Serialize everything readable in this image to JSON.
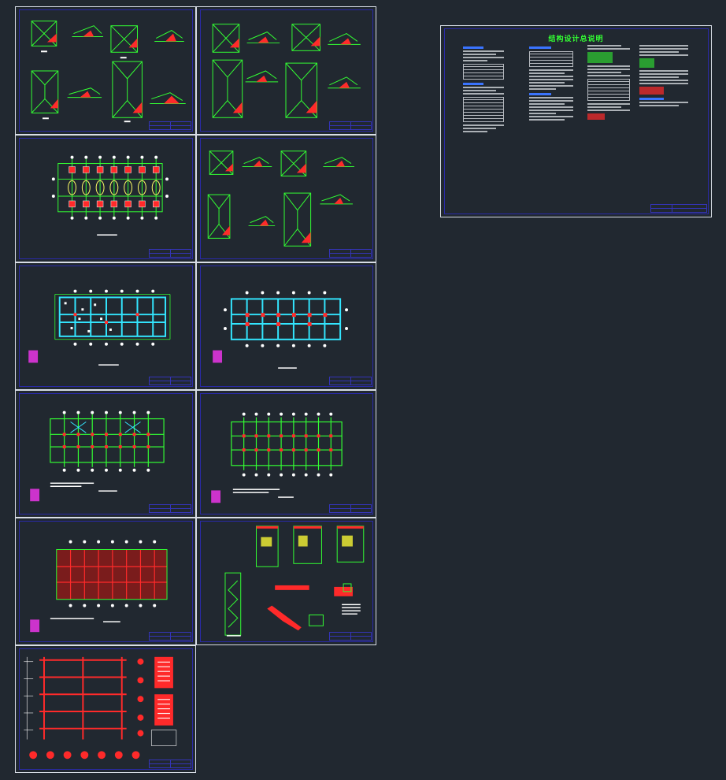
{
  "sheets": [
    {
      "id": "s1",
      "type": "roof-details"
    },
    {
      "id": "s2",
      "type": "roof-details"
    },
    {
      "id": "s3",
      "type": "foundation-plan"
    },
    {
      "id": "s4",
      "type": "roof-details"
    },
    {
      "id": "s5",
      "type": "column-plan"
    },
    {
      "id": "s6",
      "type": "column-plan"
    },
    {
      "id": "s7",
      "type": "beam-plan"
    },
    {
      "id": "s8",
      "type": "beam-plan"
    },
    {
      "id": "s9",
      "type": "slab-plan"
    },
    {
      "id": "s10",
      "type": "stair-details"
    },
    {
      "id": "s11",
      "type": "frame-elevation"
    },
    {
      "id": "s12",
      "type": "design-notes"
    }
  ],
  "design_notes_sheet": {
    "title": "结构设计总说明"
  },
  "colors": {
    "background": "#212830",
    "frame": "#2a2aa8",
    "sheet_border": "#d8dde6",
    "grid": "#33ff33",
    "beam": "#ff2a2a",
    "column": "#ff2a2a",
    "slab": "#8a2020",
    "axis_bubble": "#ffffff",
    "highlight": "#33e6ff",
    "legend": "#cc33cc"
  }
}
